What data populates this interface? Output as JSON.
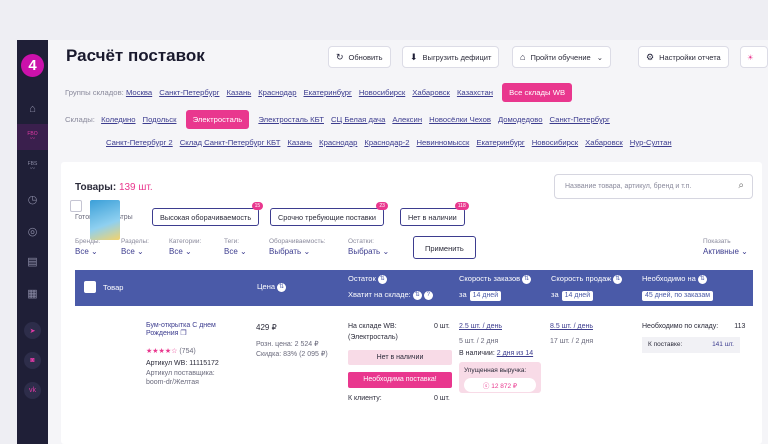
{
  "sidebar": {
    "logo": "4",
    "items": [
      {
        "icon": "graduation-cap-icon",
        "glyph": "⌂"
      },
      {
        "icon": "fbo-chart-icon",
        "glyph": "FBO"
      },
      {
        "icon": "fbs-chart-icon",
        "glyph": "FBS"
      },
      {
        "icon": "timer-icon",
        "glyph": "◷"
      },
      {
        "icon": "coin-icon",
        "glyph": "◎"
      },
      {
        "icon": "document-icon",
        "glyph": "▤"
      },
      {
        "icon": "calculator-icon",
        "glyph": "▦"
      }
    ],
    "social": [
      "telegram-icon",
      "instagram-icon",
      "vk-icon"
    ]
  },
  "header": {
    "title": "Расчёт поставок",
    "buttons": {
      "refresh": "Обновить",
      "export": "Выгрузить дефицит",
      "tutorial": "Пройти обучение",
      "settings": "Настройки отчета"
    }
  },
  "warehouse_groups": {
    "label": "Группы складов:",
    "items": [
      "Москва",
      "Санкт-Петербург",
      "Казань",
      "Краснодар",
      "Екатеринбург",
      "Новосибирск",
      "Хабаровск",
      "Казахстан"
    ],
    "active": "Все склады WB"
  },
  "warehouses": {
    "label": "Склады:",
    "row1_before": [
      "Коледино",
      "Подольск"
    ],
    "active": "Электросталь",
    "row1_after": [
      "Электросталь КБТ",
      "СЦ Белая дача",
      "Алексин",
      "Новосёлки Чехов",
      "Домодедово",
      "Санкт-Петербург"
    ],
    "row2": [
      "Санкт-Петербург 2",
      "Склад Санкт-Петербург КБТ",
      "Казань",
      "Краснодар",
      "Краснодар-2",
      "Невинномысск",
      "Екатеринбург",
      "Новосибирск",
      "Хабаровск",
      "Нур-Султан"
    ]
  },
  "products": {
    "title": "Товары:",
    "count": "139 шт.",
    "search_placeholder": "Название товара, артикул, бренд и т.п.",
    "filters_label": "Готовые фильтры",
    "filters": [
      {
        "label": "Высокая оборачиваемость",
        "badge": "15"
      },
      {
        "label": "Срочно требующие поставки",
        "badge": "23"
      },
      {
        "label": "Нет в наличии",
        "badge": "118"
      }
    ],
    "dropdowns": [
      {
        "label": "Бренды:",
        "value": "Все"
      },
      {
        "label": "Разделы:",
        "value": "Все"
      },
      {
        "label": "Категории:",
        "value": "Все"
      },
      {
        "label": "Теги:",
        "value": "Все"
      },
      {
        "label": "Оборачиваемость:",
        "value": "Выбрать"
      },
      {
        "label": "Остатки:",
        "value": "Выбрать"
      }
    ],
    "apply": "Применить",
    "show_label": "Показать",
    "show_value": "Активные"
  },
  "table": {
    "headers": {
      "product": "Товар",
      "price": "Цена",
      "stock": "Остаток",
      "enough": "Хватит на складе:",
      "order_speed": "Скорость заказов",
      "order_period": "14 дней",
      "sales_speed": "Скорость продаж",
      "sales_period": "14 дней",
      "needed": "Необходимо на",
      "needed_period": "45 дней, по заказам",
      "za": "за"
    },
    "row": {
      "name_line1": "Бум-открытка С днем",
      "name_line2": "Рождения",
      "stars": "★★★★☆",
      "reviews": "(754)",
      "article": "Артикул WB: 11115172",
      "supplier_label": "Артикул поставщика:",
      "supplier_value": "boom-dr/Желтая",
      "price": "429 ₽",
      "retail": "Розн. цена: 2 524 ₽",
      "discount": "Скидка: 83% (2 095 ₽)",
      "stock_label": "На складе WB:",
      "stock_wh": "(Электросталь)",
      "stock_value": "0 шт.",
      "no_stock": "Нет в наличии",
      "need_supply": "Необходима поставка!",
      "to_client": "К клиенту:",
      "to_client_value": "0 шт.",
      "order_day": "2.5 шт. / день",
      "order_2d": "5 шт. / 2 дня",
      "in_stock": "В наличии:",
      "in_stock_days": "2 дня из 14",
      "lost": "Упущенная выручка:",
      "lost_sum": "12 872 ₽",
      "sales_day": "8.5 шт. / день",
      "sales_2d": "17 шт. / 2 дня",
      "need_wh": "Необходимо по складу:",
      "need_wh_value": "113",
      "supply": "К поставке:",
      "supply_value": "141 шт."
    }
  }
}
